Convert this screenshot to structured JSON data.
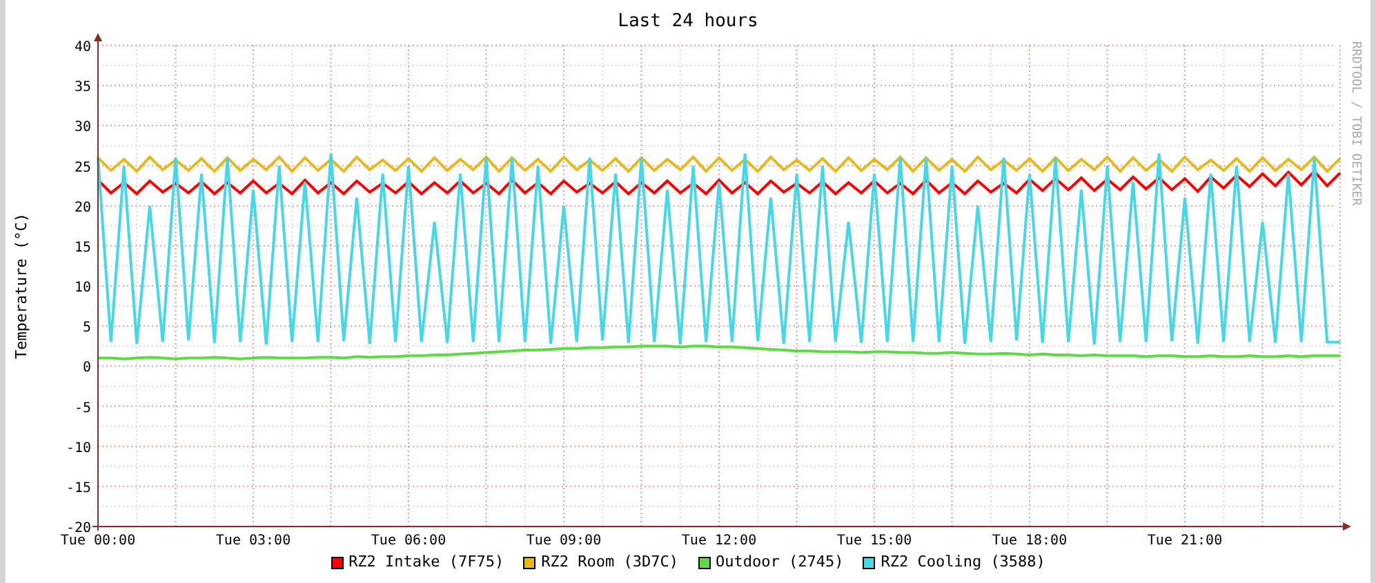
{
  "graph": {
    "credit": "RRDTOOL / TOBI OETIKER",
    "chart_data": {
      "type": "line",
      "grid": true,
      "title": "Last 24 hours",
      "ylabel": "Temperature (°C)",
      "ylim": [
        -20,
        40
      ],
      "yticks": [
        -20,
        -15,
        -10,
        -5,
        0,
        5,
        10,
        15,
        20,
        25,
        30,
        35,
        40
      ],
      "categories": [
        "Tue 00:00",
        null,
        null,
        null,
        null,
        null,
        null,
        null,
        null,
        null,
        null,
        null,
        "Tue 03:00",
        null,
        null,
        null,
        null,
        null,
        null,
        null,
        null,
        null,
        null,
        null,
        "Tue 06:00",
        null,
        null,
        null,
        null,
        null,
        null,
        null,
        null,
        null,
        null,
        null,
        "Tue 09:00",
        null,
        null,
        null,
        null,
        null,
        null,
        null,
        null,
        null,
        null,
        null,
        "Tue 12:00",
        null,
        null,
        null,
        null,
        null,
        null,
        null,
        null,
        null,
        null,
        null,
        "Tue 15:00",
        null,
        null,
        null,
        null,
        null,
        null,
        null,
        null,
        null,
        null,
        null,
        "Tue 18:00",
        null,
        null,
        null,
        null,
        null,
        null,
        null,
        null,
        null,
        null,
        null,
        "Tue 21:00",
        null,
        null,
        null,
        null,
        null,
        null,
        null,
        null,
        null,
        null,
        null,
        null
      ],
      "series": [
        {
          "name": "RZ2 Intake (7F75)",
          "color": "#ff0000",
          "values": [
            23.2,
            21.6,
            22.9,
            21.5,
            23.1,
            21.7,
            22.8,
            21.6,
            23,
            21.5,
            22.9,
            21.6,
            23.1,
            21.6,
            22.8,
            21.5,
            23.2,
            21.6,
            22.9,
            21.5,
            23.1,
            21.7,
            22.8,
            21.6,
            23,
            21.5,
            22.9,
            21.6,
            23.1,
            21.6,
            22.8,
            21.5,
            23.2,
            21.6,
            22.9,
            21.5,
            23.1,
            21.7,
            22.8,
            21.6,
            23,
            21.5,
            22.9,
            21.6,
            23.1,
            21.6,
            22.8,
            21.5,
            23.2,
            21.6,
            22.9,
            21.5,
            23.1,
            21.7,
            22.8,
            21.6,
            23,
            21.5,
            22.9,
            21.6,
            23.1,
            21.6,
            22.8,
            21.5,
            23.2,
            21.6,
            22.9,
            21.5,
            23.1,
            21.7,
            22.8,
            21.6,
            23.3,
            21.9,
            23.4,
            22,
            23.5,
            21.9,
            23.3,
            22,
            23.6,
            22.1,
            23.5,
            22,
            23.4,
            21.8,
            23.6,
            22.2,
            23.8,
            22.4,
            24,
            22.5,
            24.2,
            22.6,
            24.3,
            22.5,
            24.1
          ]
        },
        {
          "name": "RZ2 Room (3D7C)",
          "color": "#e8b81c",
          "values": [
            26,
            24.4,
            25.8,
            24.3,
            26.1,
            24.5,
            25.7,
            24.4,
            25.9,
            24.3,
            26,
            24.4,
            25.8,
            24.5,
            26.1,
            24.3,
            26,
            24.4,
            25.8,
            24.3,
            26.1,
            24.5,
            25.7,
            24.4,
            25.9,
            24.3,
            26,
            24.4,
            25.8,
            24.5,
            26.1,
            24.3,
            26,
            24.4,
            25.8,
            24.3,
            26.1,
            24.5,
            25.7,
            24.4,
            25.9,
            24.3,
            26,
            24.4,
            25.8,
            24.5,
            26.1,
            24.3,
            26,
            24.4,
            25.8,
            24.3,
            26.1,
            24.5,
            25.7,
            24.4,
            25.9,
            24.3,
            26,
            24.4,
            25.8,
            24.5,
            26.1,
            24.3,
            26,
            24.4,
            25.8,
            24.3,
            26.1,
            24.5,
            25.7,
            24.4,
            25.9,
            24.3,
            26,
            24.4,
            25.8,
            24.5,
            26.1,
            24.3,
            26,
            24.4,
            25.8,
            24.3,
            26.1,
            24.5,
            25.7,
            24.4,
            25.9,
            24.3,
            26,
            24.4,
            25.8,
            24.5,
            26.1,
            24.3,
            25.9
          ]
        },
        {
          "name": "Outdoor (2745)",
          "color": "#5ddb45",
          "values": [
            1,
            1,
            0.9,
            1,
            1.1,
            1,
            0.9,
            1,
            1,
            1.1,
            1,
            0.9,
            1,
            1.1,
            1,
            1,
            1,
            1.1,
            1.1,
            1,
            1.2,
            1.1,
            1.2,
            1.2,
            1.3,
            1.3,
            1.4,
            1.4,
            1.5,
            1.6,
            1.7,
            1.8,
            1.9,
            2,
            2,
            2.1,
            2.2,
            2.2,
            2.3,
            2.3,
            2.4,
            2.4,
            2.5,
            2.5,
            2.5,
            2.4,
            2.5,
            2.5,
            2.4,
            2.4,
            2.3,
            2.2,
            2.1,
            2,
            1.9,
            1.9,
            1.8,
            1.8,
            1.8,
            1.7,
            1.8,
            1.8,
            1.7,
            1.7,
            1.6,
            1.6,
            1.7,
            1.6,
            1.5,
            1.5,
            1.6,
            1.5,
            1.4,
            1.5,
            1.4,
            1.4,
            1.3,
            1.4,
            1.3,
            1.3,
            1.3,
            1.2,
            1.3,
            1.3,
            1.2,
            1.2,
            1.3,
            1.2,
            1.2,
            1.3,
            1.2,
            1.2,
            1.3,
            1.2,
            1.3,
            1.3,
            1.3
          ]
        },
        {
          "name": "RZ2 Cooling (3588)",
          "color": "#44d8e8",
          "values": [
            26,
            3,
            25,
            2.8,
            20,
            3,
            26,
            3.2,
            24,
            2.9,
            26,
            3,
            22,
            2.7,
            25,
            3,
            23,
            3,
            26.5,
            3.1,
            21,
            2.8,
            24,
            3,
            25,
            3,
            18,
            2.9,
            24,
            3,
            26,
            3,
            26,
            3,
            25,
            2.8,
            20,
            3,
            26,
            3.2,
            24,
            2.9,
            26,
            3,
            22,
            2.7,
            25,
            3,
            23,
            3,
            26.5,
            3.1,
            21,
            2.8,
            24,
            3,
            25,
            3,
            18,
            2.9,
            24,
            3,
            26,
            3,
            26,
            3,
            25,
            2.8,
            20,
            3,
            26,
            3.2,
            24,
            2.9,
            26,
            3,
            22,
            2.7,
            25,
            3,
            23,
            3,
            26.5,
            3.1,
            21,
            2.8,
            24,
            3,
            25,
            3,
            18,
            2.9,
            24,
            3,
            26,
            3,
            3
          ]
        }
      ]
    }
  }
}
